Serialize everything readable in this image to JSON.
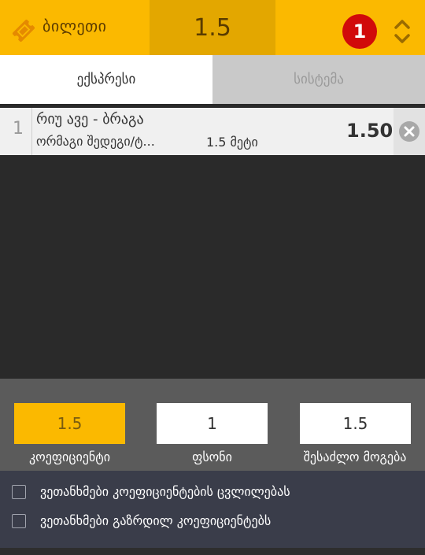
{
  "header": {
    "ticket_label": "ბილეთი",
    "total_odds": "1.5",
    "selection_count": "1"
  },
  "tabs": [
    {
      "label": "ექსპრესი",
      "active": true
    },
    {
      "label": "სისტემა",
      "active": false
    }
  ],
  "bets": [
    {
      "index": "1",
      "match": "რიუ ავე - ბრაგა",
      "market": "ორმაგი შედეგი/ტ...",
      "selection": "1.5 მეტი",
      "odds": "1.50"
    }
  ],
  "summary": {
    "coefficient_value": "1.5",
    "coefficient_label": "კოეფიციენტი",
    "stake_value": "1",
    "stake_label": "ფსონი",
    "potential_win_value": "1.5",
    "potential_win_label": "შესაძლო მოგება"
  },
  "options": [
    {
      "label": "ვეთანხმები კოეფიციენტების ცვლილებას",
      "checked": false
    },
    {
      "label": "ვეთანხმები გაზრდილ კოეფიციენტებს",
      "checked": false
    }
  ],
  "colors": {
    "accent": "#fbb900",
    "badge": "#d10a0a"
  },
  "icons": {
    "ticket": "ticket-icon",
    "expand": "chevron-up-down-icon",
    "remove": "close-circle-icon"
  }
}
